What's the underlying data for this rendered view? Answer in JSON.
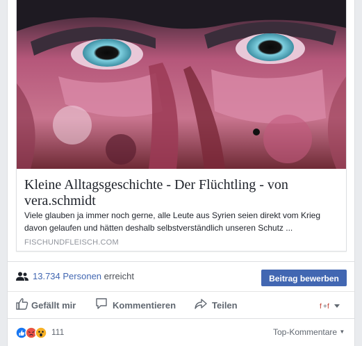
{
  "link": {
    "title": "Kleine Alltagsgeschichte - Der Flüchtling - von vera.schmidt",
    "description": "Viele glauben ja immer noch gerne, alle Leute aus Syrien seien direkt vom Krieg davon gelaufen und hätten deshalb selbstverständlich unseren Schutz ...",
    "domain": "FISCHUNDFLEISCH.COM"
  },
  "reach": {
    "count_text": "13.734 Personen",
    "suffix": "erreicht",
    "promote_label": "Beitrag bewerben"
  },
  "actions": {
    "like": "Gefällt mir",
    "comment": "Kommentieren",
    "share": "Teilen"
  },
  "reactions": {
    "count": "111",
    "sort_label": "Top-Kommentare"
  },
  "colors": {
    "accent": "#4267b2",
    "muted": "#606770",
    "border": "#dddfe2"
  }
}
